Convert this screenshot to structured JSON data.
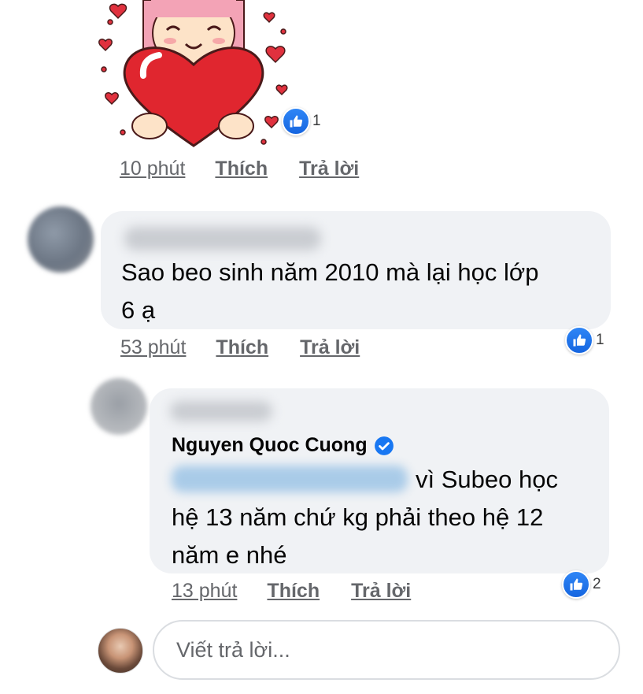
{
  "colors": {
    "like_blue": "#1b74e4",
    "bubble_bg": "#f0f2f5",
    "muted_text": "#65676b",
    "verified": "#1877f2"
  },
  "sticker": {
    "icon": "heart-girl-sticker",
    "reaction_count": "1"
  },
  "sticker_actions": {
    "time": "10 phút",
    "like": "Thích",
    "reply": "Trả lời"
  },
  "comment1": {
    "text_line1": "Sao beo sinh năm 2010 mà lại học lớp",
    "text_line2": "6 ạ",
    "reaction_count": "1",
    "time": "53 phút",
    "like": "Thích",
    "reply": "Trả lời"
  },
  "comment2": {
    "author": "Nguyen Quoc Cuong",
    "text_line1": "vì Subeo học",
    "text_line2": "hệ 13 năm chứ kg phải theo hệ 12",
    "text_line3": "năm e nhé",
    "reaction_count": "2",
    "time": "13 phút",
    "like": "Thích",
    "reply": "Trả lời"
  },
  "reply_box": {
    "placeholder": "Viết trả lời..."
  }
}
